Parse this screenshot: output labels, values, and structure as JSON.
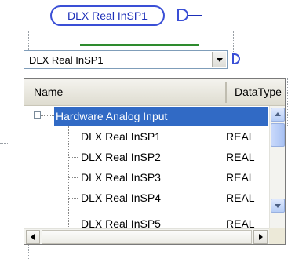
{
  "variable": {
    "label": "DLX Real InSP1"
  },
  "combo": {
    "value": "DLX Real InSP1"
  },
  "table": {
    "columns": {
      "name": "Name",
      "type": "DataType"
    },
    "group": {
      "label": "Hardware Analog Input",
      "expanded": true
    },
    "rows": [
      {
        "name": "DLX Real InSP1",
        "type": "REAL"
      },
      {
        "name": "DLX Real InSP2",
        "type": "REAL"
      },
      {
        "name": "DLX Real InSP3",
        "type": "REAL"
      },
      {
        "name": "DLX Real InSP4",
        "type": "REAL"
      },
      {
        "name": "DLX Real InSP5",
        "type": "REAL"
      }
    ]
  },
  "colors": {
    "selection": "#316ac5",
    "pin": "#3a4fd6",
    "wire": "#2e8b2e"
  }
}
